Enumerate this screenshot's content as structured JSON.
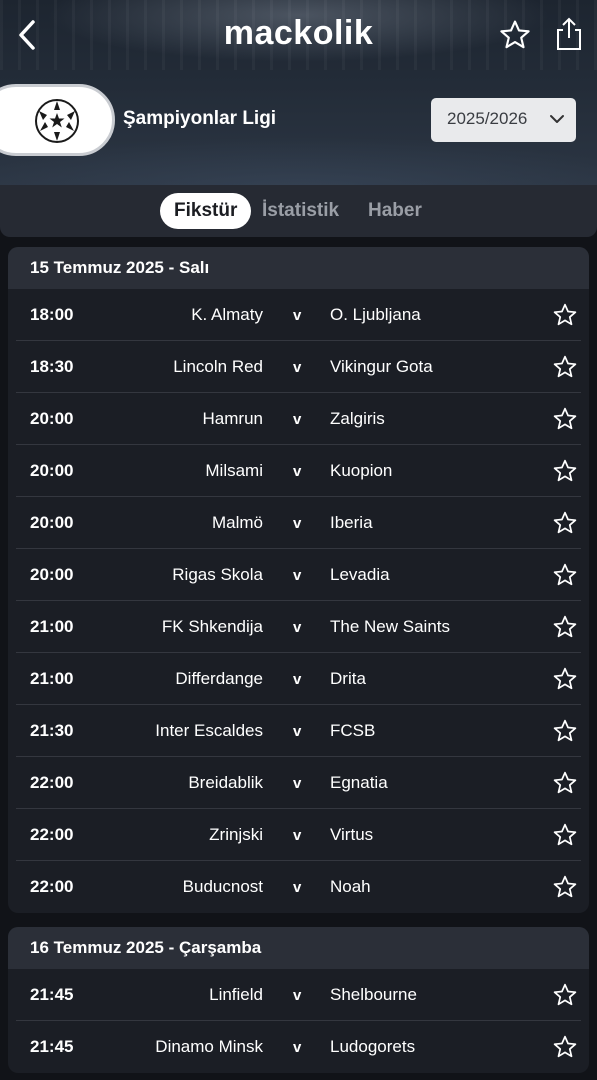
{
  "header": {
    "logo_text": "mackolik",
    "league_name": "Şampiyonlar Ligi",
    "season": "2025/2026",
    "icons": {
      "back": "chevron-left-icon",
      "favorite": "star-outline-icon",
      "share": "share-icon",
      "league_logo": "champions-league-starball-icon",
      "dropdown": "chevron-down-icon"
    }
  },
  "tabs": [
    {
      "label": "Fikstür",
      "active": true
    },
    {
      "label": "İstatistik",
      "active": false
    },
    {
      "label": "Haber",
      "active": false
    }
  ],
  "days": [
    {
      "date_label": "15 Temmuz 2025 - Salı",
      "matches": [
        {
          "time": "18:00",
          "home": "K. Almaty",
          "vs": "v",
          "away": "O. Ljubljana"
        },
        {
          "time": "18:30",
          "home": "Lincoln Red",
          "vs": "v",
          "away": "Vikingur Gota"
        },
        {
          "time": "20:00",
          "home": "Hamrun",
          "vs": "v",
          "away": "Zalgiris"
        },
        {
          "time": "20:00",
          "home": "Milsami",
          "vs": "v",
          "away": "Kuopion"
        },
        {
          "time": "20:00",
          "home": "Malmö",
          "vs": "v",
          "away": "Iberia"
        },
        {
          "time": "20:00",
          "home": "Rigas Skola",
          "vs": "v",
          "away": "Levadia"
        },
        {
          "time": "21:00",
          "home": "FK Shkendija",
          "vs": "v",
          "away": "The New Saints"
        },
        {
          "time": "21:00",
          "home": "Differdange",
          "vs": "v",
          "away": "Drita"
        },
        {
          "time": "21:30",
          "home": "Inter Escaldes",
          "vs": "v",
          "away": "FCSB"
        },
        {
          "time": "22:00",
          "home": "Breidablik",
          "vs": "v",
          "away": "Egnatia"
        },
        {
          "time": "22:00",
          "home": "Zrinjski",
          "vs": "v",
          "away": "Virtus"
        },
        {
          "time": "22:00",
          "home": "Buducnost",
          "vs": "v",
          "away": "Noah"
        }
      ]
    },
    {
      "date_label": "16 Temmuz 2025 - Çarşamba",
      "matches": [
        {
          "time": "21:45",
          "home": "Linfield",
          "vs": "v",
          "away": "Shelbourne"
        },
        {
          "time": "21:45",
          "home": "Dinamo Minsk",
          "vs": "v",
          "away": "Ludogorets"
        }
      ]
    }
  ],
  "colors": {
    "background": "#111318",
    "card": "#1b1e25",
    "day_header": "#2b2f38",
    "active_tab_bg": "#ffffff",
    "inactive_tab_text": "#9a9ea6"
  }
}
